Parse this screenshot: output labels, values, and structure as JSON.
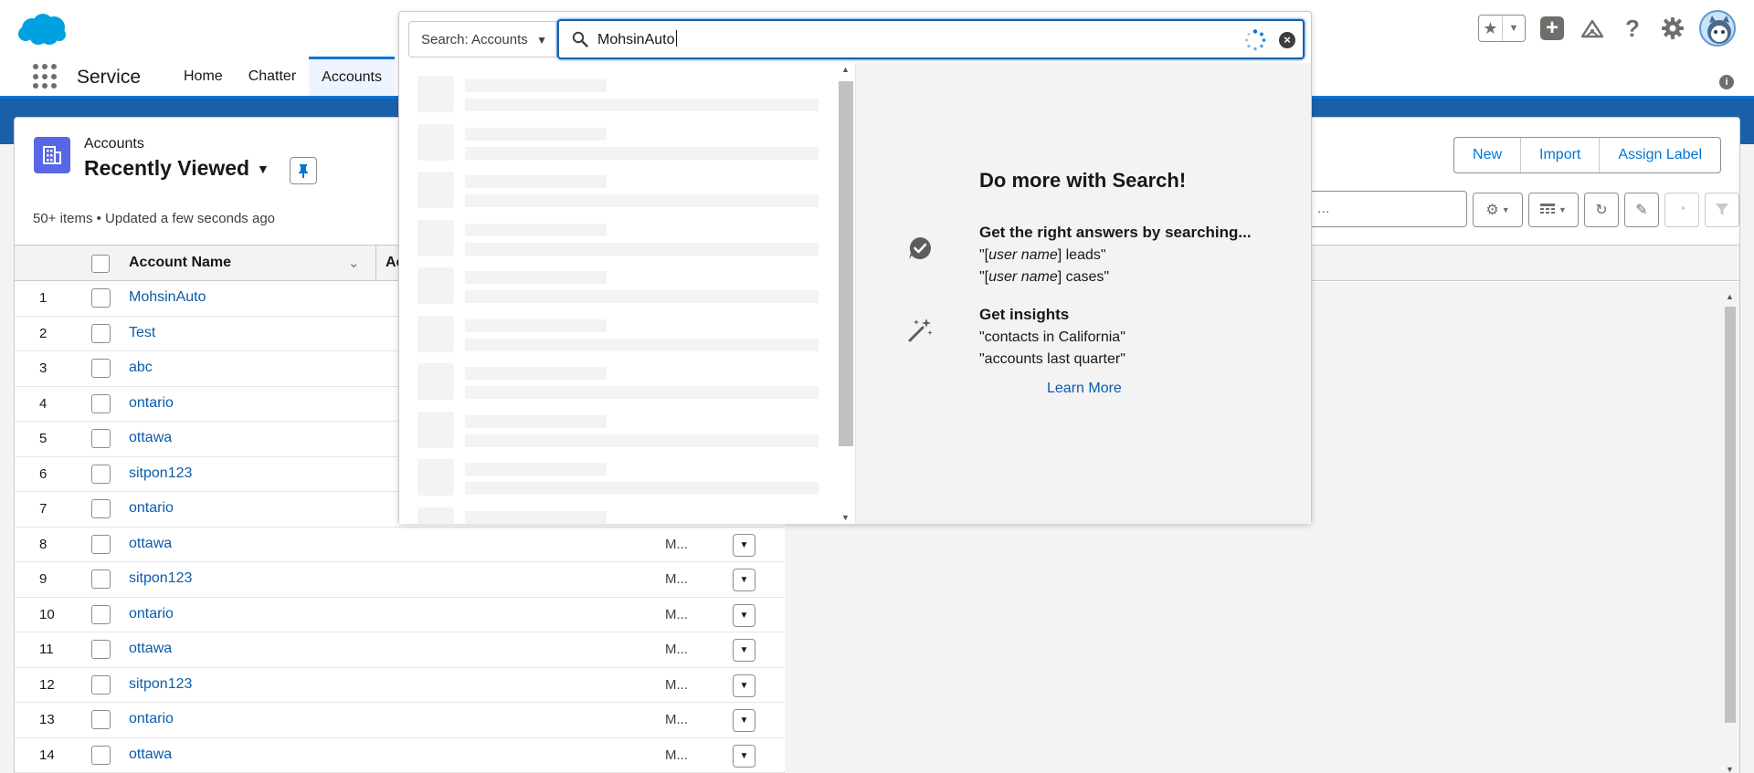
{
  "global_header": {
    "search_scope": "Search: Accounts",
    "search_value": "MohsinAuto"
  },
  "nav": {
    "app_name": "Service",
    "tabs": [
      {
        "label": "Home"
      },
      {
        "label": "Chatter"
      },
      {
        "label": "Accounts"
      }
    ]
  },
  "list_view": {
    "object_label": "Accounts",
    "title": "Recently Viewed",
    "meta": "50+ items • Updated a few seconds ago",
    "buttons": {
      "new": "New",
      "import": "Import",
      "assign_label": "Assign Label"
    },
    "search_placeholder": "...",
    "columns": {
      "account_name": "Account Name",
      "next_column_partial": "Ac"
    },
    "rows": [
      {
        "num": "1",
        "name": "MohsinAuto",
        "trunc": ""
      },
      {
        "num": "2",
        "name": "Test",
        "trunc": ""
      },
      {
        "num": "3",
        "name": "abc",
        "trunc": ""
      },
      {
        "num": "4",
        "name": "ontario",
        "trunc": ""
      },
      {
        "num": "5",
        "name": "ottawa",
        "trunc": ""
      },
      {
        "num": "6",
        "name": "sitpon123",
        "trunc": ""
      },
      {
        "num": "7",
        "name": "ontario",
        "trunc": ""
      },
      {
        "num": "8",
        "name": "ottawa",
        "trunc": "M..."
      },
      {
        "num": "9",
        "name": "sitpon123",
        "trunc": "M..."
      },
      {
        "num": "10",
        "name": "ontario",
        "trunc": "M..."
      },
      {
        "num": "11",
        "name": "ottawa",
        "trunc": "M..."
      },
      {
        "num": "12",
        "name": "sitpon123",
        "trunc": "M..."
      },
      {
        "num": "13",
        "name": "ontario",
        "trunc": "M..."
      },
      {
        "num": "14",
        "name": "ottawa",
        "trunc": "M..."
      }
    ]
  },
  "search_tips": {
    "title": "Do more with Search!",
    "tip1": {
      "heading": "Get the right answers by searching...",
      "line1_open": "\"[",
      "line1_em": "user name",
      "line1_close": "] leads\"",
      "line2_open": "\"[",
      "line2_em": "user name",
      "line2_close": "] cases\""
    },
    "tip2": {
      "heading": "Get insights",
      "line1": "\"contacts in California\"",
      "line2": "\"accounts last quarter\""
    },
    "learn_more": "Learn More"
  },
  "colors": {
    "brand": "#0176d3",
    "link": "#0b5cab",
    "object_icon": "#5867e8",
    "header_band": "#1b5fa8"
  },
  "icons": [
    "salesforce-logo",
    "star-icon",
    "chevron-down-icon",
    "plus-icon",
    "trailhead-icon",
    "help-icon",
    "gear-icon",
    "avatar",
    "app-launcher-icon",
    "info-icon",
    "account-icon",
    "pin-icon",
    "search-icon",
    "spinner-icon",
    "clear-icon",
    "table-icon",
    "refresh-icon",
    "edit-icon",
    "chart-icon",
    "filter-icon",
    "checkmark-bubble-icon",
    "magic-wand-icon"
  ]
}
